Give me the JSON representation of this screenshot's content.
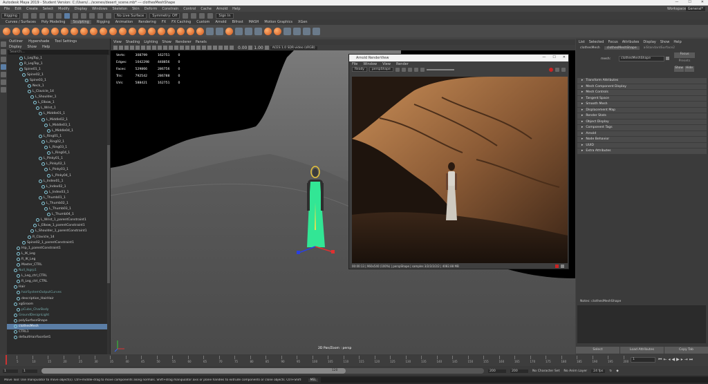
{
  "window": {
    "title": "Autodesk Maya 2019 - Student Version: C:/Users/.../scenes/desert_scene.mb* --- clothesMeshShape",
    "controls": [
      "—",
      "☐",
      "✕"
    ]
  },
  "menubar": {
    "items": [
      "File",
      "Edit",
      "Create",
      "Select",
      "Modify",
      "Display",
      "Windows",
      "Skeleton",
      "Skin",
      "Deform",
      "Constrain",
      "Control",
      "Cache",
      "Arnold",
      "Help"
    ],
    "workspace_label": "Workspace:",
    "workspace_value": "General*"
  },
  "statusline": {
    "mode": "Rigging",
    "objects": "No Live Surface",
    "symmetry": "Symmetry: Off",
    "signin": "Sign In"
  },
  "shelf": {
    "tabs": [
      "Curves / Surfaces",
      "Poly Modeling",
      "Sculpting",
      "Rigging",
      "Animation",
      "Rendering",
      "FX",
      "FX Caching",
      "Custom",
      "Arnold",
      "Bifrost",
      "MASH",
      "Motion Graphics",
      "XGen"
    ],
    "active": "Sculpting"
  },
  "outliner": {
    "tabs": [
      "Outliner",
      "Hypershade",
      "Tool Settings"
    ],
    "menu": [
      "Display",
      "Show",
      "Help"
    ],
    "search_placeholder": "Search...",
    "items": [
      {
        "label": "L_LegTop_1",
        "indent": 3
      },
      {
        "label": "R_LegTop_1",
        "indent": 3
      },
      {
        "label": "Spine01_1",
        "indent": 3
      },
      {
        "label": "Spine02_1",
        "indent": 4
      },
      {
        "label": "Spine03_1",
        "indent": 5
      },
      {
        "label": "Neck_1",
        "indent": 6
      },
      {
        "label": "L_Clavicle_14",
        "indent": 6
      },
      {
        "label": "L_Shoulder_1",
        "indent": 7
      },
      {
        "label": "L_Elbow_1",
        "indent": 8
      },
      {
        "label": "L_Wrist_1",
        "indent": 9
      },
      {
        "label": "L_Middle01_1",
        "indent": 10
      },
      {
        "label": "L_Middle02_1",
        "indent": 11
      },
      {
        "label": "L_Middle03_1",
        "indent": 12
      },
      {
        "label": "L_Middle04_1",
        "indent": 13
      },
      {
        "label": "L_Ring01_1",
        "indent": 10
      },
      {
        "label": "L_Ring02_1",
        "indent": 11
      },
      {
        "label": "L_Ring03_1",
        "indent": 12
      },
      {
        "label": "L_Ring04_1",
        "indent": 13
      },
      {
        "label": "L_Pinky01_1",
        "indent": 10
      },
      {
        "label": "L_Pinky02_1",
        "indent": 11
      },
      {
        "label": "L_Pinky03_1",
        "indent": 12
      },
      {
        "label": "L_Pinky04_1",
        "indent": 13
      },
      {
        "label": "L_Index01_1",
        "indent": 10
      },
      {
        "label": "L_Index02_1",
        "indent": 11
      },
      {
        "label": "L_Index03_1",
        "indent": 12
      },
      {
        "label": "L_Thumb01_1",
        "indent": 10
      },
      {
        "label": "L_Thumb02_1",
        "indent": 11
      },
      {
        "label": "L_Thumb03_1",
        "indent": 12
      },
      {
        "label": "L_Thumb04_1",
        "indent": 13
      },
      {
        "label": "L_Wrist_1_parentConstraint1",
        "indent": 9
      },
      {
        "label": "L_Elbow_1_parentConstraint1",
        "indent": 8
      },
      {
        "label": "L_Shoulder_1_parentConstraint1",
        "indent": 7
      },
      {
        "label": "R_Clavicle_14",
        "indent": 6
      },
      {
        "label": "Spine02_1_parentConstraint1",
        "indent": 4
      },
      {
        "label": "Hip_1_parentConstraint1",
        "indent": 2
      },
      {
        "label": "L_IK_Leg",
        "indent": 2
      },
      {
        "label": "R_IK_Leg",
        "indent": 2
      },
      {
        "label": "Master_CTRL",
        "indent": 2
      },
      {
        "label": "Null_Ikgrp1",
        "indent": 1,
        "dim": true
      },
      {
        "label": "L_Leg_ctrl_CTRL",
        "indent": 2
      },
      {
        "label": "R_Leg_ctrl_CTRL",
        "indent": 2
      },
      {
        "label": "Hair",
        "indent": 1
      },
      {
        "label": "hairSystemOutputCurves",
        "indent": 2,
        "dim": true
      },
      {
        "label": "description_HairHair",
        "indent": 2
      },
      {
        "label": "xgGroom",
        "indent": 1
      },
      {
        "label": "pCube_CharBody",
        "indent": 2,
        "dim": true
      },
      {
        "label": "GroundDesignLight",
        "indent": 1,
        "dim": true
      },
      {
        "label": "polySurfaceShape",
        "indent": 1
      },
      {
        "label": "clothesMesh",
        "indent": 1,
        "selected": true
      },
      {
        "label": "CTRL1",
        "indent": 1
      },
      {
        "label": "defaultHairFaceSet1",
        "indent": 1
      }
    ]
  },
  "viewport": {
    "menu": [
      "View",
      "Shading",
      "Lighting",
      "Show",
      "Renderer",
      "Panels"
    ],
    "gamma": "0.00",
    "exposure": "1.00",
    "colorspace": "ACES 1.0 SDR-video (sRGB)",
    "hud": [
      {
        "label": "Verts:",
        "a": "308799",
        "b": "162751",
        "c": "0"
      },
      {
        "label": "Edges:",
        "a": "1042298",
        "b": "448856",
        "c": "0"
      },
      {
        "label": "Faces:",
        "a": "529866",
        "b": "286756",
        "c": "0"
      },
      {
        "label": "Tris:",
        "a": "792542",
        "b": "286788",
        "c": "0"
      },
      {
        "label": "UVs:",
        "a": "588421",
        "b": "162751",
        "c": "0"
      }
    ],
    "camera_label": "2D Pan/Zoom : persp"
  },
  "renderview": {
    "title": "Arnold RenderView",
    "menu": [
      "File",
      "Window",
      "View",
      "Render"
    ],
    "status": "Ready",
    "camera": "perspShape",
    "status_line": "00:00:13 | 960x540 (100%) | perspShape | samples 3/2/2/2/2/2 | 4082.88 MB"
  },
  "attribute_editor": {
    "menu": [
      "List",
      "Selected",
      "Focus",
      "Attributes",
      "Display",
      "Show",
      "Help"
    ],
    "tabs": [
      "clothesMesh",
      "clothesMeshShape",
      "aiStandardSurface2"
    ],
    "mesh_label": "mesh:",
    "mesh_value": "clothesMeshShape",
    "focus_btn": "Focus",
    "presets_btn": "Presets",
    "show_btn": "Show",
    "hide_btn": "Hide",
    "sections": [
      "Transform Attributes",
      "Mesh Component Display",
      "Mesh Controls",
      "Tangent Space",
      "Smooth Mesh",
      "Displacement Map",
      "Render Stats",
      "Object Display",
      "Component Tags",
      "Arnold",
      "Node Behavior",
      "UUID",
      "Extra Attributes"
    ],
    "notes_label": "Notes: clothesMeshShape",
    "buttons": [
      "Select",
      "Load Attributes",
      "Copy Tab"
    ]
  },
  "timeline": {
    "ticks": [
      "5",
      "10",
      "15",
      "20",
      "25",
      "30",
      "35",
      "40",
      "45",
      "50",
      "55",
      "60",
      "65",
      "70",
      "75",
      "80",
      "85",
      "90",
      "95",
      "100",
      "105",
      "110",
      "115",
      "120",
      "125",
      "130",
      "135",
      "140",
      "145",
      "150",
      "155",
      "160",
      "165",
      "170",
      "175",
      "180",
      "185",
      "190",
      "195",
      "200"
    ],
    "current_frame": "1"
  },
  "rangebar": {
    "start": "1",
    "start2": "1",
    "end": "120",
    "end2": "200",
    "end3": "200",
    "character_set": "No Character Set",
    "anim_layer": "No Anim Layer",
    "fps": "24 fps"
  },
  "helpline": {
    "text": "Move Tool: Use manipulator to move object(s). Ctrl+middle-drag to move components along normals. Shift+drag manipulator axis or plane handles to extrude components or clone objects. Ctrl+Shift+drag to constrain movement to a connected edge. Use D or INSERT to change the pivot position and axis orientation.",
    "mode": "MEL"
  }
}
